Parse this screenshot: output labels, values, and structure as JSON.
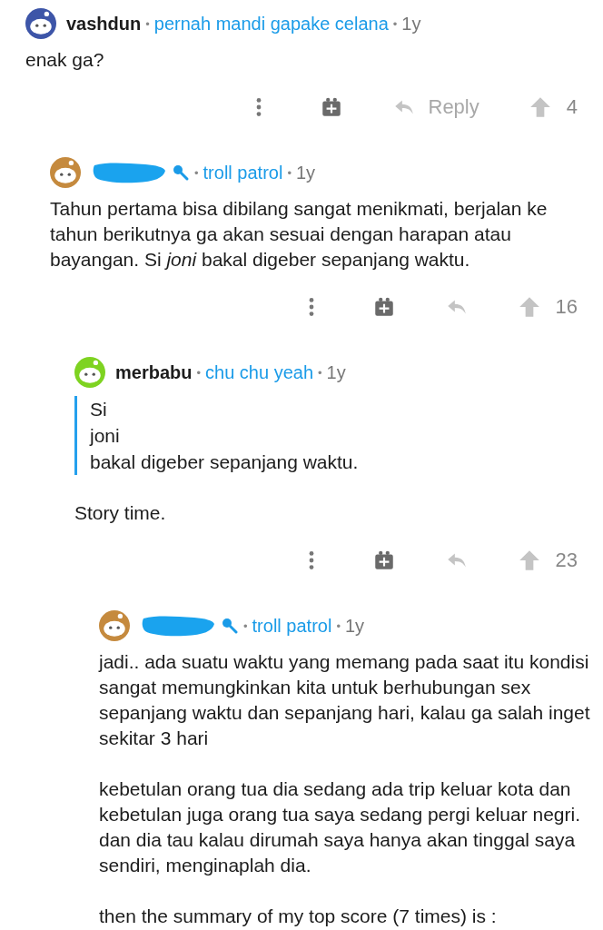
{
  "separator": "•",
  "comments": [
    {
      "author": "vashdun",
      "redacted": false,
      "color": "#3d55a8",
      "flair": "pernah mandi gapake celana",
      "flair_icon": false,
      "age": "1y",
      "body": [
        {
          "kind": "paragraph",
          "text": "enak ga?"
        }
      ],
      "actions": {
        "reply_label": "Reply",
        "score": "4"
      },
      "children": [
        {
          "redacted": true,
          "color": "#c58a3e",
          "flair": "troll patrol",
          "flair_icon": true,
          "age": "1y",
          "body": [
            {
              "kind": "paragraph",
              "text": "Tahun pertama bisa dibilang sangat menikmati, berjalan ke tahun berikutnya ga akan sesuai dengan harapan atau bayangan. Si *joni* bakal digeber sepanjang waktu."
            }
          ],
          "actions": {
            "score": "16"
          },
          "children": [
            {
              "author": "merbabu",
              "redacted": false,
              "color": "#7ed321",
              "flair": "chu chu yeah",
              "flair_icon": false,
              "age": "1y",
              "body": [
                {
                  "kind": "quote",
                  "lines": [
                    "Si",
                    "joni",
                    "bakal digeber sepanjang waktu."
                  ]
                },
                {
                  "kind": "paragraph",
                  "text": "Story time."
                }
              ],
              "actions": {
                "score": "23"
              },
              "children": [
                {
                  "redacted": true,
                  "color": "#c58a3e",
                  "flair": "troll patrol",
                  "flair_icon": true,
                  "age": "1y",
                  "body": [
                    {
                      "kind": "paragraph",
                      "text": "jadi.. ada suatu waktu yang memang pada saat itu kondisi sangat memungkinkan kita untuk berhubungan sex sepanjang waktu dan sepanjang hari, kalau ga salah inget sekitar 3 hari"
                    },
                    {
                      "kind": "paragraph",
                      "text": "kebetulan orang tua dia sedang ada trip keluar kota dan kebetulan juga orang tua saya sedang pergi keluar negri. dan dia tau kalau dirumah saya hanya akan tinggal saya sendiri, menginaplah dia."
                    },
                    {
                      "kind": "paragraph",
                      "text": "then the summary of my top score (7 times) is :"
                    }
                  ]
                }
              ]
            }
          ]
        }
      ]
    }
  ]
}
